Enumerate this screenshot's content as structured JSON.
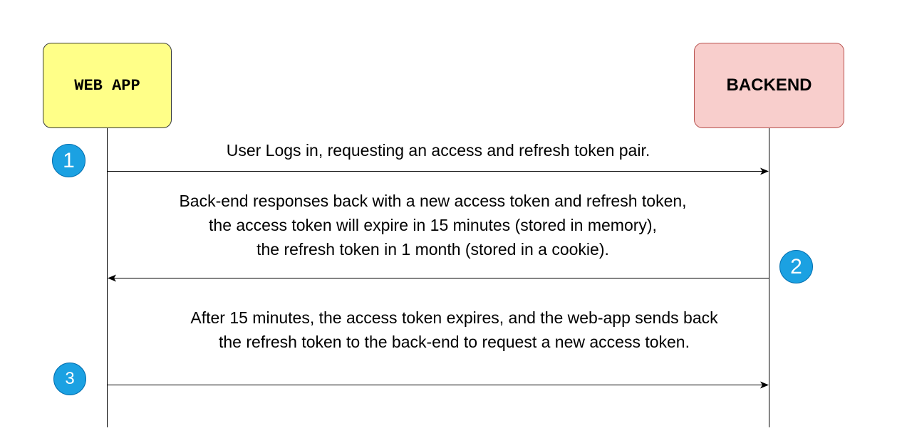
{
  "participants": {
    "web_app": "WEB APP",
    "backend": "BACKEND"
  },
  "steps": [
    {
      "number": "1",
      "direction": "web-app-to-backend",
      "text": [
        "User Logs in, requesting an access and refresh token pair."
      ]
    },
    {
      "number": "2",
      "direction": "backend-to-web-app",
      "text": [
        "Back-end responses back with a new access token and refresh token,",
        "the access token will expire in 15 minutes (stored in memory),",
        "the refresh token in 1 month (stored in a cookie)."
      ]
    },
    {
      "number": "3",
      "direction": "web-app-to-backend",
      "text": [
        "After 15 minutes, the access token expires, and the web-app sends back",
        "the refresh token to the back-end to request a new access token."
      ]
    }
  ],
  "colors": {
    "web_app_fill": "#ffff88",
    "backend_fill": "#f8cecc",
    "badge_fill": "#1ba1e2",
    "arrow": "#000000"
  }
}
